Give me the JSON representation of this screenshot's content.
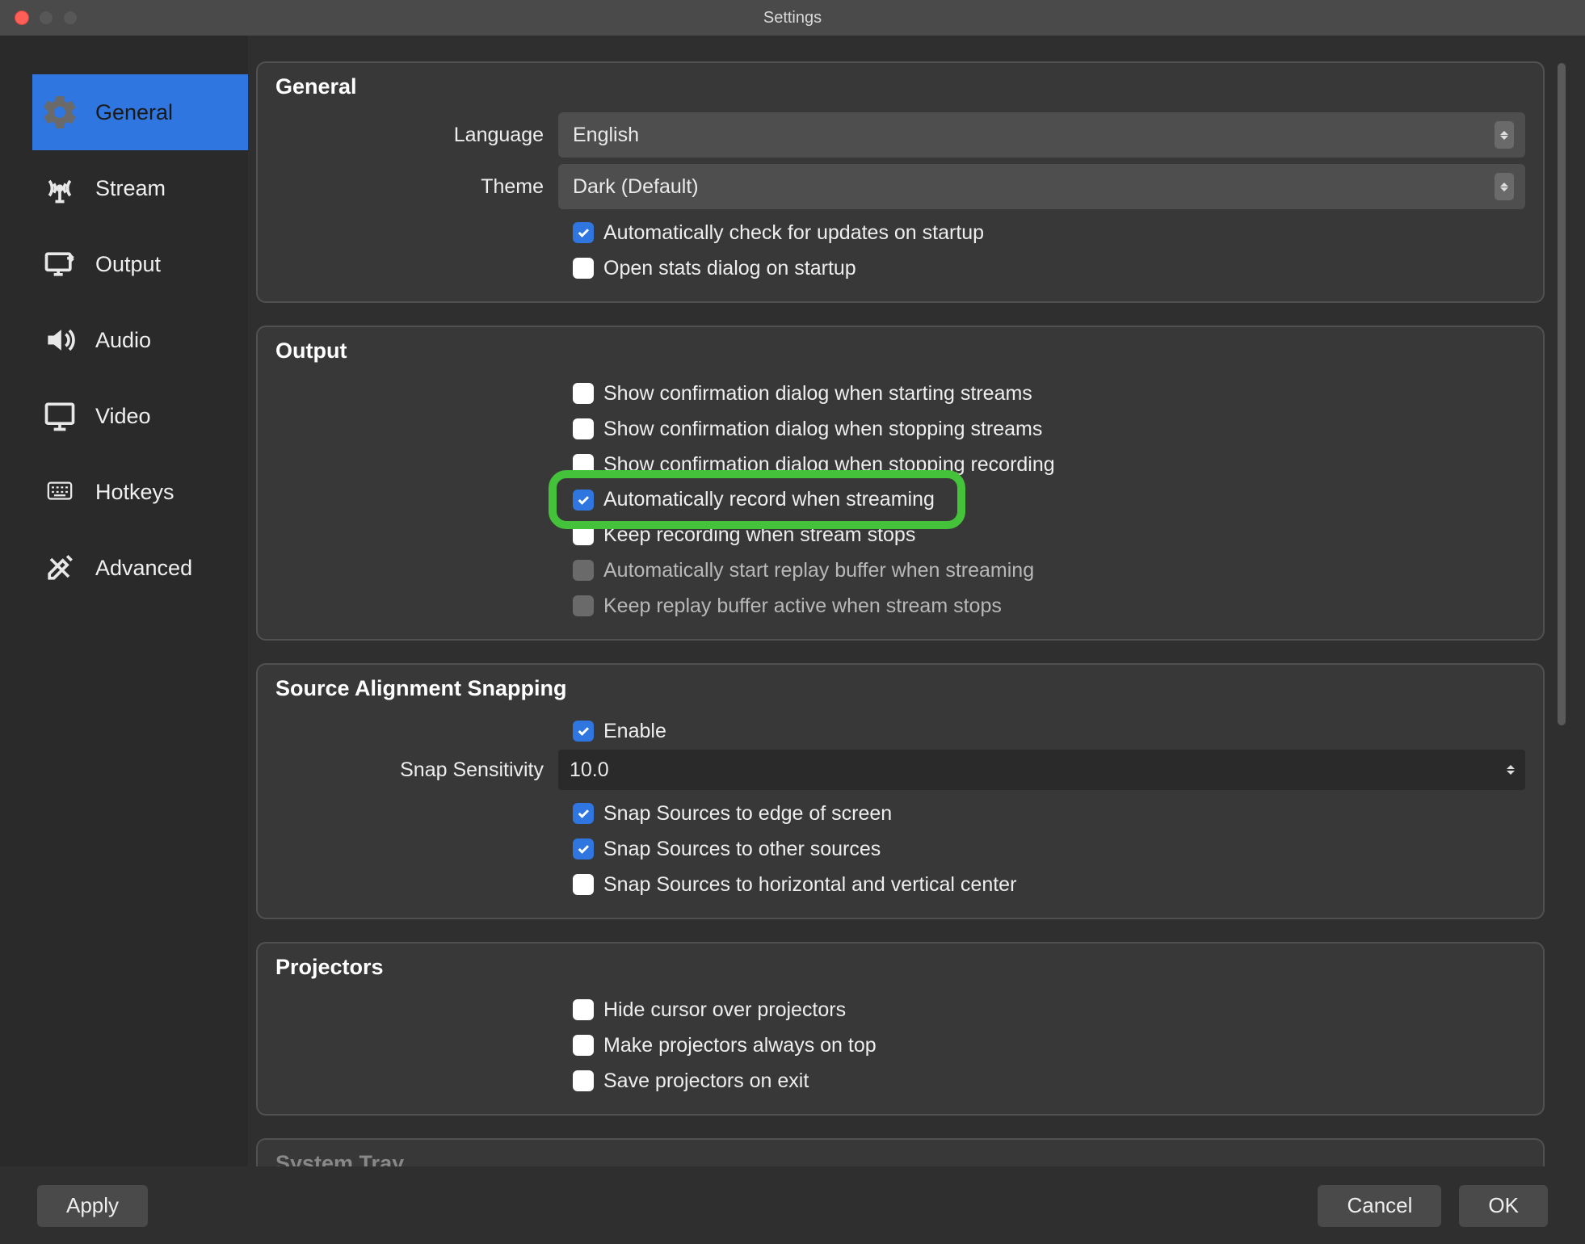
{
  "window": {
    "title": "Settings"
  },
  "sidebar": {
    "items": [
      {
        "label": "General"
      },
      {
        "label": "Stream"
      },
      {
        "label": "Output"
      },
      {
        "label": "Audio"
      },
      {
        "label": "Video"
      },
      {
        "label": "Hotkeys"
      },
      {
        "label": "Advanced"
      }
    ]
  },
  "general": {
    "title": "General",
    "language_label": "Language",
    "language_value": "English",
    "theme_label": "Theme",
    "theme_value": "Dark (Default)",
    "auto_update": "Automatically check for updates on startup",
    "open_stats": "Open stats dialog on startup"
  },
  "output": {
    "title": "Output",
    "confirm_start": "Show confirmation dialog when starting streams",
    "confirm_stop": "Show confirmation dialog when stopping streams",
    "confirm_stop_rec": "Show confirmation dialog when stopping recording",
    "auto_record": "Automatically record when streaming",
    "keep_recording": "Keep recording when stream stops",
    "auto_replay": "Automatically start replay buffer when streaming",
    "keep_replay": "Keep replay buffer active when stream stops"
  },
  "snapping": {
    "title": "Source Alignment Snapping",
    "enable": "Enable",
    "sensitivity_label": "Snap Sensitivity",
    "sensitivity_value": "10.0",
    "snap_edge": "Snap Sources to edge of screen",
    "snap_other": "Snap Sources to other sources",
    "snap_center": "Snap Sources to horizontal and vertical center"
  },
  "projectors": {
    "title": "Projectors",
    "hide_cursor": "Hide cursor over projectors",
    "on_top": "Make projectors always on top",
    "save_exit": "Save projectors on exit"
  },
  "systray": {
    "title": "System Tray"
  },
  "buttons": {
    "apply": "Apply",
    "cancel": "Cancel",
    "ok": "OK"
  }
}
